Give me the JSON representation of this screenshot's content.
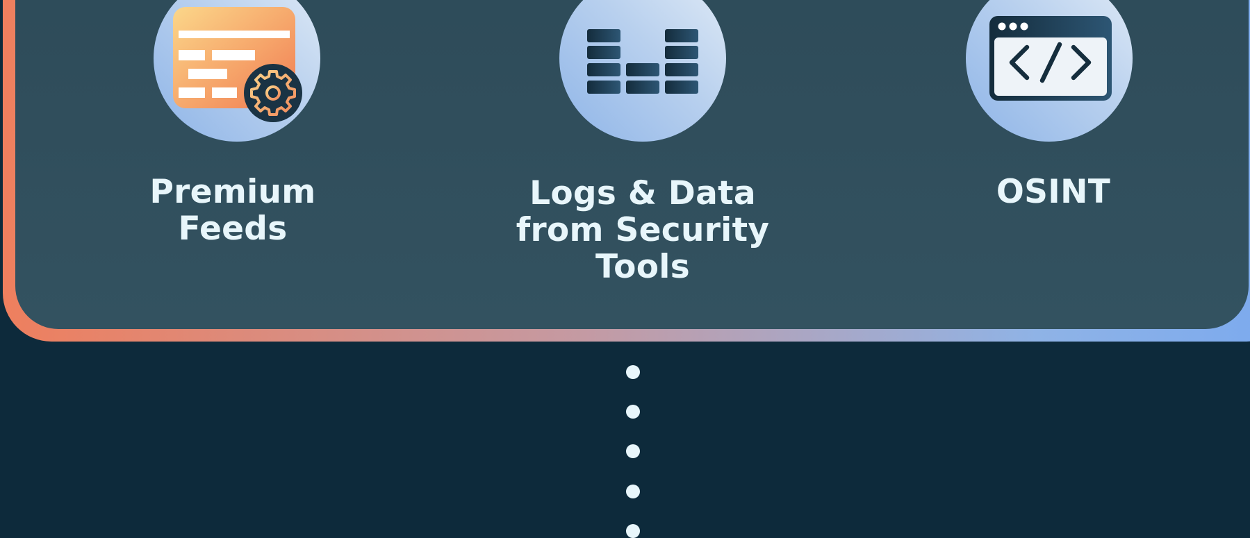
{
  "sources": [
    {
      "label": "Premium\nFeeds",
      "icon": "premium-feed-gear-icon"
    },
    {
      "label": "Logs & Data\nfrom Security\nTools",
      "icon": "log-bars-icon"
    },
    {
      "label": "OSINT",
      "icon": "browser-code-icon"
    }
  ],
  "colors": {
    "background": "#0d2a3b",
    "panel": "#2f4d5b",
    "border_start": "#ee7f5e",
    "border_end": "#7aa9ef",
    "text": "#e8f6fb"
  }
}
